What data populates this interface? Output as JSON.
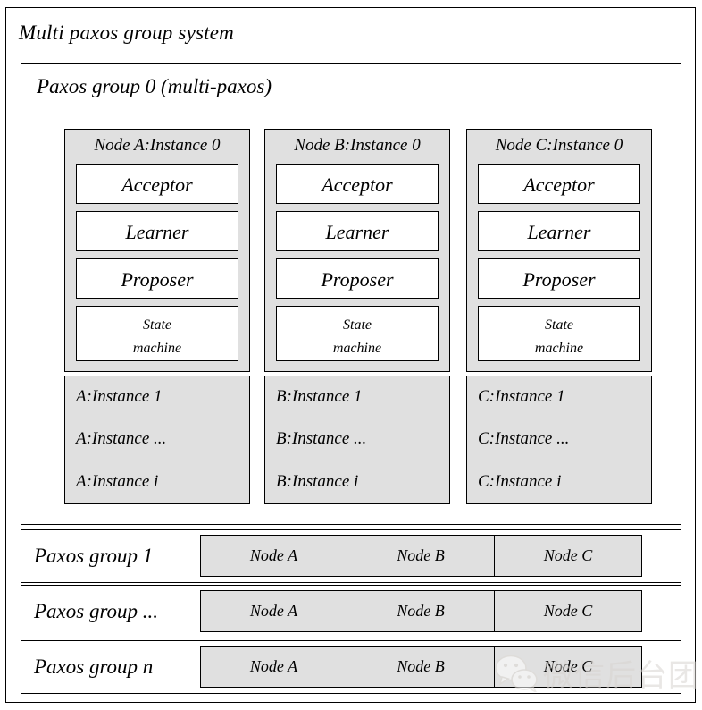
{
  "diagram": {
    "title": "Multi paxos group system",
    "group0": {
      "title": "Paxos group 0 (multi-paxos)",
      "columns": [
        {
          "instance0_title": "Node A:Instance 0",
          "roles": [
            "Acceptor",
            "Learner",
            "Proposer"
          ],
          "state_machine_line1": "State",
          "state_machine_line2": "machine",
          "instances": [
            "A:Instance 1",
            "A:Instance ...",
            "A:Instance i"
          ]
        },
        {
          "instance0_title": "Node B:Instance 0",
          "roles": [
            "Acceptor",
            "Learner",
            "Proposer"
          ],
          "state_machine_line1": "State",
          "state_machine_line2": "machine",
          "instances": [
            "B:Instance 1",
            "B:Instance ...",
            "B:Instance i"
          ]
        },
        {
          "instance0_title": "Node C:Instance 0",
          "roles": [
            "Acceptor",
            "Learner",
            "Proposer"
          ],
          "state_machine_line1": "State",
          "state_machine_line2": "machine",
          "instances": [
            "C:Instance 1",
            "C:Instance ...",
            "C:Instance i"
          ]
        }
      ]
    },
    "group_rows": [
      {
        "title": "Paxos group 1",
        "nodes": [
          "Node A",
          "Node B",
          "Node C"
        ]
      },
      {
        "title": "Paxos group ...",
        "nodes": [
          "Node A",
          "Node B",
          "Node C"
        ]
      },
      {
        "title": "Paxos group n",
        "nodes": [
          "Node A",
          "Node B",
          "Node C"
        ]
      }
    ]
  },
  "watermark": {
    "text": "微信后台团队",
    "logo_icon": "wechat-icon"
  },
  "colors": {
    "box_fill_gray": "#e0e0e0",
    "box_fill_white": "#ffffff",
    "stroke": "#000000",
    "watermark_gray": "#d8d4d0"
  }
}
